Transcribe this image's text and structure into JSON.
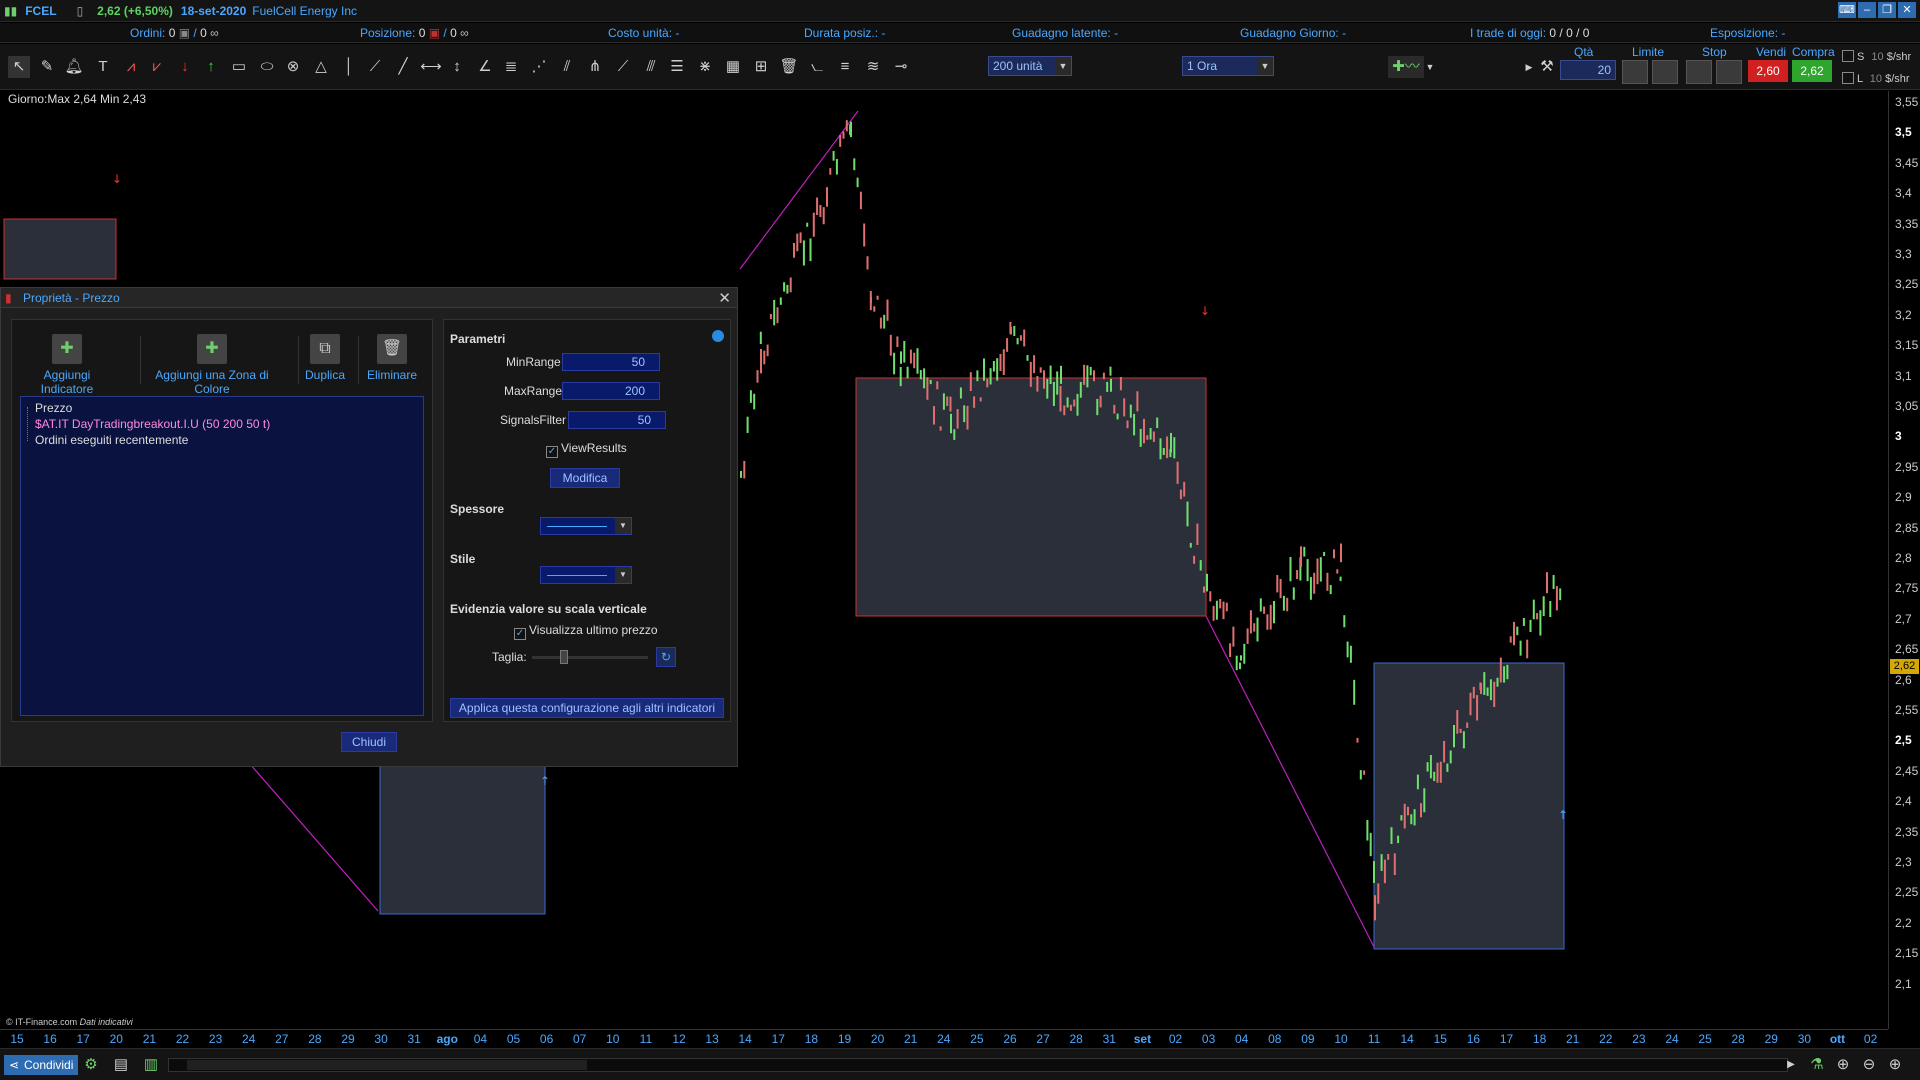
{
  "topbar": {
    "symbol": "FCEL",
    "price": "2,62 (+6,50%)",
    "date": "18-set-2020",
    "name": "FuelCell Energy Inc"
  },
  "infobar": {
    "orders_label": "Ordini:",
    "orders_value": "0",
    "orders_value2": "0",
    "position_label": "Posizione:",
    "position_value": "0",
    "position_value2": "0",
    "unit_cost": "Costo unità: -",
    "duration": "Durata posiz.: -",
    "unrealized": "Guadagno latente: -",
    "daily_gain": "Guadagno Giorno: -",
    "trades_label": "I trade di oggi:",
    "trades_value": "0 / 0 / 0",
    "exposure": "Esposizione: -"
  },
  "toolbar": {
    "units_select": "200 unità",
    "timeframe_select": "1 Ora",
    "qty_label": "Qtà",
    "qty_value": "20",
    "limit_label": "Limite",
    "stop_label": "Stop",
    "sell_label": "Vendi",
    "buy_label": "Compra",
    "sell_price": "2,60",
    "buy_price": "2,62",
    "s_label": "S",
    "l_label": "L",
    "s_qty": "10",
    "l_qty": "10",
    "unit_label": "$/shr"
  },
  "chart": {
    "stat_line": "Giorno:Max 2,64 Min 2,43",
    "copyright": "© IT-Finance.com",
    "copyright_note": "Dati indicativi",
    "last_price": "2,62",
    "y_ticks": [
      "3,55",
      "3,5",
      "3,45",
      "3,4",
      "3,35",
      "3,3",
      "3,25",
      "3,2",
      "3,15",
      "3,1",
      "3,05",
      "3",
      "2,95",
      "2,9",
      "2,85",
      "2,8",
      "2,75",
      "2,7",
      "2,65",
      "2,6",
      "2,55",
      "2,5",
      "2,45",
      "2,4",
      "2,35",
      "2,3",
      "2,25",
      "2,2",
      "2,15",
      "2,1"
    ],
    "x_ticks": [
      "15",
      "16",
      "17",
      "20",
      "21",
      "22",
      "23",
      "24",
      "27",
      "28",
      "29",
      "30",
      "31",
      "ago",
      "04",
      "05",
      "06",
      "07",
      "10",
      "11",
      "12",
      "13",
      "14",
      "17",
      "18",
      "19",
      "20",
      "21",
      "24",
      "25",
      "26",
      "27",
      "28",
      "31",
      "set",
      "02",
      "03",
      "04",
      "08",
      "09",
      "10",
      "11",
      "14",
      "15",
      "16",
      "17",
      "18",
      "21",
      "22",
      "23",
      "24",
      "25",
      "28",
      "29",
      "30",
      "ott",
      "02"
    ]
  },
  "panel": {
    "title": "Proprietà - Prezzo",
    "btn_add_indicator": "Aggiungi Indicatore",
    "btn_add_zone": "Aggiungi una Zona di Colore",
    "btn_duplicate": "Duplica",
    "btn_delete": "Eliminare",
    "tree": [
      "Prezzo",
      "$AT.IT DayTradingbreakout.I.U (50 200 50 t)",
      "Ordini eseguiti recentemente"
    ],
    "params_head": "Parametri",
    "minrange_label": "MinRange",
    "minrange_value": "50",
    "maxrange_label": "MaxRange",
    "maxrange_value": "200",
    "signals_label": "SignalsFilter",
    "signals_value": "50",
    "viewresults_label": "ViewResults",
    "modify_btn": "Modifica",
    "thickness_head": "Spessore",
    "style_head": "Stile",
    "highlight_head": "Evidenzia valore su scala verticale",
    "show_last_label": "Visualizza ultimo prezzo",
    "size_label": "Taglia:",
    "apply_btn": "Applica questa configurazione agli altri indicatori",
    "close_btn": "Chiudi"
  },
  "bottombar": {
    "share_label": "Condividi"
  }
}
